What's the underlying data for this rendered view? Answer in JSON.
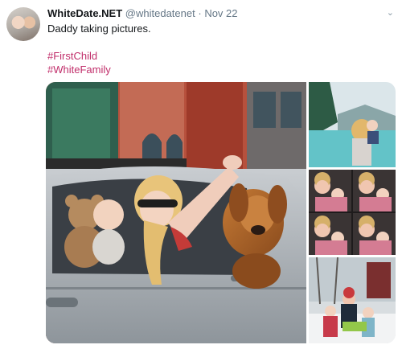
{
  "tweet": {
    "display_name": "WhiteDate.NET",
    "handle": "@whitedatenet",
    "separator": "·",
    "date": "Nov 22",
    "text": "Daddy taking pictures.",
    "hashtags": [
      "#FirstChild",
      "#WhiteFamily"
    ]
  },
  "icons": {
    "menu": "chevron-down-icon"
  },
  "colors": {
    "hashtag": "#c12f6b",
    "handle": "#657786"
  }
}
